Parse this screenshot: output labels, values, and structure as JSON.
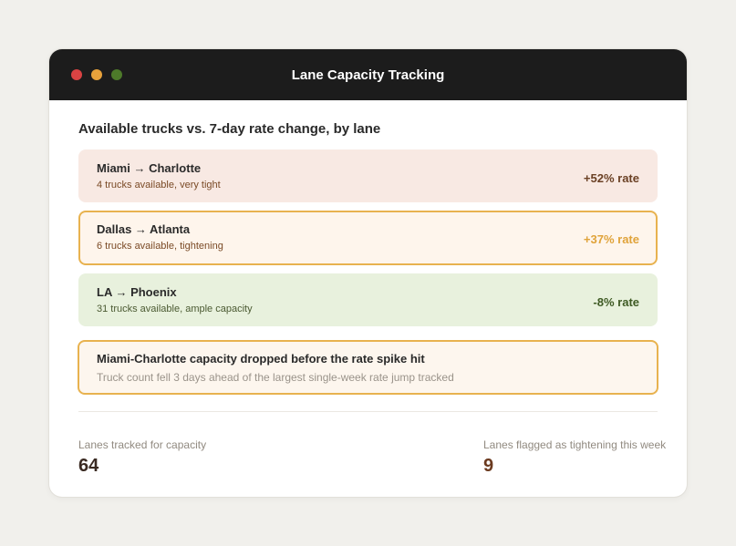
{
  "window": {
    "title": "Lane Capacity Tracking"
  },
  "heading": "Available trucks vs. 7-day rate change, by lane",
  "lanes": [
    {
      "name": "Miami → Charlotte",
      "detail": "4 trucks available, very tight",
      "rate": "+52% rate",
      "status": "very tight"
    },
    {
      "name": "Dallas → Atlanta",
      "detail": "6 trucks available, tightening",
      "rate": "+37% rate",
      "status": "tightening"
    },
    {
      "name": "LA → Phoenix",
      "detail": "31 trucks available, ample capacity",
      "rate": "-8% rate",
      "status": "ample"
    }
  ],
  "insight": {
    "title": "Miami-Charlotte capacity dropped before the rate spike hit",
    "detail": "Truck count fell 3 days ahead of the largest single-week rate jump tracked"
  },
  "stats": {
    "tracked_label": "Lanes tracked for capacity",
    "tracked_value": "64",
    "flagged_label": "Lanes flagged as tightening this week",
    "flagged_value": "9"
  },
  "colors": {
    "titlebar": "#1c1c1c",
    "tight_bg": "#f8e9e3",
    "tightening_accent": "#e8b24f",
    "ample_bg": "#e8f1dd"
  }
}
